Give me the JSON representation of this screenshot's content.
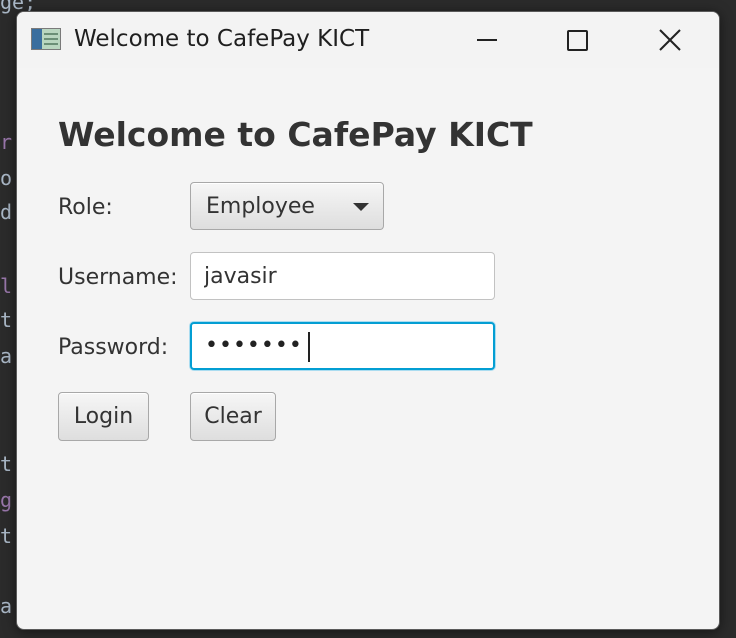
{
  "window": {
    "title": "Welcome to CafePay KICT",
    "icon": "app-icon",
    "controls": {
      "minimize_icon": "minimize-icon",
      "maximize_icon": "maximize-icon",
      "close_icon": "close-icon"
    }
  },
  "form": {
    "heading": "Welcome to CafePay KICT",
    "role": {
      "label": "Role:",
      "selected": "Employee"
    },
    "username": {
      "label": "Username:",
      "value": "javasir"
    },
    "password": {
      "label": "Password:",
      "masked_value": "•••••••"
    },
    "buttons": {
      "login": "Login",
      "clear": "Clear"
    }
  },
  "background_code": [
    "ge;",
    "r",
    "o",
    "d",
    "l",
    "t",
    "a",
    "t.",
    "g",
    "t'",
    "a"
  ],
  "colors": {
    "focus_border": "#039ed3",
    "window_bg": "#f4f4f4",
    "editor_bg": "#2b2b2b"
  }
}
